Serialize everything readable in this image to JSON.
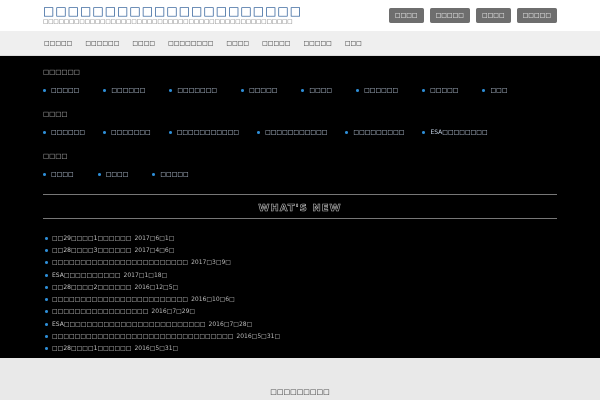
{
  "header": {
    "site_title": "□□□□□□□□□□□□□□□□□□□□□",
    "site_description": "□□□□□□□□□□□□□□□□□□□□□□□□□□□□□□□□□□□□□□□□□□□□□□□□",
    "buttons": [
      "□□□□",
      "□□□□□",
      "□□□□",
      "□□□□□"
    ]
  },
  "nav": {
    "items": [
      "□□□□□",
      "□□□□□□",
      "□□□□",
      "□□□□□□□□",
      "□□□□",
      "□□□□□",
      "□□□□□",
      "□□□"
    ]
  },
  "sections": [
    {
      "heading": "□□□□□□",
      "links": [
        "□□□□□",
        "□□□□□□",
        "□□□□□□□",
        "□□□□□",
        "□□□□",
        "□□□□□□",
        "□□□□□",
        "□□□"
      ]
    },
    {
      "heading": "□□□□",
      "links": [
        "□□□□□□",
        "□□□□□□□",
        "□□□□□□□□□□□",
        "□□□□□□□□□□□",
        "□□□□□□□□□",
        "ESA□□□□□□□□"
      ]
    },
    {
      "heading": "□□□□",
      "links": [
        "□□□□",
        "□□□□",
        "□□□□□"
      ]
    }
  ],
  "whats_new": {
    "title": "WHAT'S NEW",
    "items": [
      {
        "text": "□□29□□□□1□□□□□□",
        "date": "2017□6□1□"
      },
      {
        "text": "□□28□□□□3□□□□□□",
        "date": "2017□4□6□"
      },
      {
        "text": "□□□□□□□□□□□□□□□□□□□□□□□□",
        "date": "2017□3□9□"
      },
      {
        "text": "ESA□□□□□□□□□□",
        "date": "2017□1□18□"
      },
      {
        "text": "□□28□□□□2□□□□□□",
        "date": "2016□12□5□"
      },
      {
        "text": "□□□□□□□□□□□□□□□□□□□□□□□□",
        "date": "2016□10□6□"
      },
      {
        "text": "□□□□□□□□□□□□□□□□□",
        "date": "2016□7□29□"
      },
      {
        "text": "ESA□□□□□□□□□□□□□□□□□□□□□□□□□",
        "date": "2016□7□28□"
      },
      {
        "text": "□□□□□□□□□□□□□□□□□□□□□□□□□□□□□□□□",
        "date": "2016□5□31□"
      },
      {
        "text": "□□28□□□□1□□□□□□",
        "date": "2016□5□31□"
      }
    ]
  },
  "footer": {
    "title": "□□□□□□□□□"
  }
}
